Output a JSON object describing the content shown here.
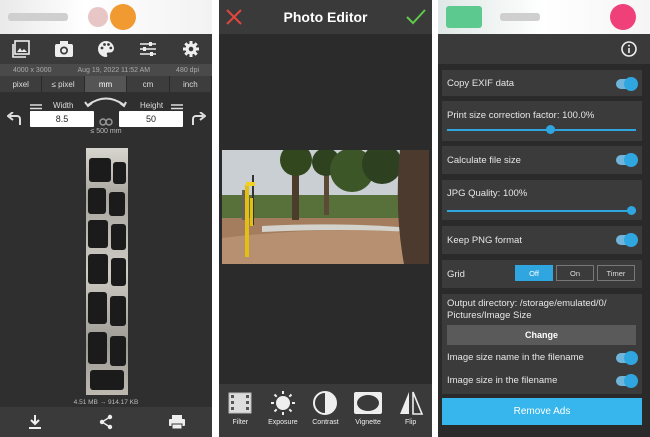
{
  "size_editor": {
    "image_info": [
      "4000 x 3000",
      "Aug 19, 2022 11:52 AM",
      "480 dpi"
    ],
    "units": [
      "pixel",
      "≤ pixel",
      "mm",
      "cm",
      "inch"
    ],
    "selected_unit": "mm",
    "width_label": "Width",
    "height_label": "Height",
    "width_value": "8.5",
    "height_value": "50",
    "limit_text": "≤ 500 mm",
    "file_size_text": "4.51 MB → 914.17 KB",
    "top_icons": [
      "gallery-icon",
      "camera-icon",
      "palette-icon",
      "sliders-icon",
      "settings-icon"
    ],
    "bottom_icons": [
      "download-icon",
      "share-icon",
      "print-icon"
    ]
  },
  "photo_editor": {
    "title": "Photo Editor",
    "tools": [
      {
        "label": "Filter",
        "icon": "filter-icon"
      },
      {
        "label": "Exposure",
        "icon": "exposure-icon"
      },
      {
        "label": "Contrast",
        "icon": "contrast-icon"
      },
      {
        "label": "Vignette",
        "icon": "vignette-icon"
      },
      {
        "label": "Flip",
        "icon": "flip-icon"
      }
    ]
  },
  "settings": {
    "copy_exif": "Copy EXIF data",
    "print_factor": "Print size correction factor: 100.0%",
    "print_factor_value": 0.55,
    "calc_size": "Calculate file size",
    "jpg_quality": "JPG Quality: 100%",
    "jpg_quality_value": 1.0,
    "keep_png": "Keep PNG format",
    "grid_label": "Grid",
    "grid_options": [
      "Off",
      "On",
      "Timer"
    ],
    "grid_selected": "Off",
    "output_dir": "Output directory: /storage/emulated/0/ Pictures/Image Size",
    "change_label": "Change",
    "name_in_filename": "Image size name in the filename",
    "size_in_filename": "Image size in the filename",
    "remove_ads": "Remove Ads"
  },
  "colors": {
    "accent": "#2fa6e0",
    "panel_bg": "#2f2f2f",
    "toolbar_bg": "#3a3a3a",
    "cancel_red": "#e0463c",
    "confirm_green": "#5fc94a"
  }
}
